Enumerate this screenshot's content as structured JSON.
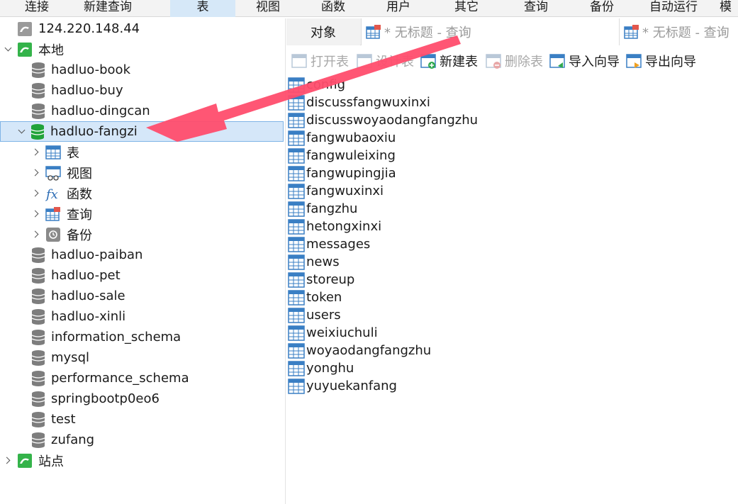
{
  "menu": [
    "连接",
    "新建查询",
    "表",
    "视图",
    "函数",
    "用户",
    "其它",
    "查询",
    "备份",
    "自动运行",
    "模"
  ],
  "tree": {
    "conn_remote": "124.220.148.44",
    "conn_local": "本地",
    "db_book": "hadluo-book",
    "db_buy": "hadluo-buy",
    "db_dingcan": "hadluo-dingcan",
    "db_fangzi": "hadluo-fangzi",
    "node_tables": "表",
    "node_views": "视图",
    "node_functions": "函数",
    "node_queries": "查询",
    "node_backups": "备份",
    "db_paiban": "hadluo-paiban",
    "db_pet": "hadluo-pet",
    "db_sale": "hadluo-sale",
    "db_xinli": "hadluo-xinli",
    "db_information_schema": "information_schema",
    "db_mysql": "mysql",
    "db_performance_schema": "performance_schema",
    "db_springboot": "springbootp0eo6",
    "db_test": "test",
    "db_zufang": "zufang",
    "site": "站点"
  },
  "tabs": {
    "objects": "对象",
    "query1": "* 无标题 - 查询",
    "query2": "* 无标题 - 查询"
  },
  "toolbar": {
    "open_table": "打开表",
    "design_table": "设计表",
    "new_table": "新建表",
    "delete_table": "删除表",
    "import_wizard": "导入向导",
    "export_wizard": "导出向导"
  },
  "tables": [
    "config",
    "discussfangwuxinxi",
    "discusswoyaodangfangzhu",
    "fangwubaoxiu",
    "fangwuleixing",
    "fangwupingjia",
    "fangwuxinxi",
    "fangzhu",
    "hetongxinxi",
    "messages",
    "news",
    "storeup",
    "token",
    "users",
    "weixiuchuli",
    "woyaodangfangzhu",
    "yonghu",
    "yuyuekanfang"
  ],
  "colors": {
    "accent": "#ff4d6d",
    "selection": "#d5e7f9",
    "db_green": "#21a33a"
  }
}
